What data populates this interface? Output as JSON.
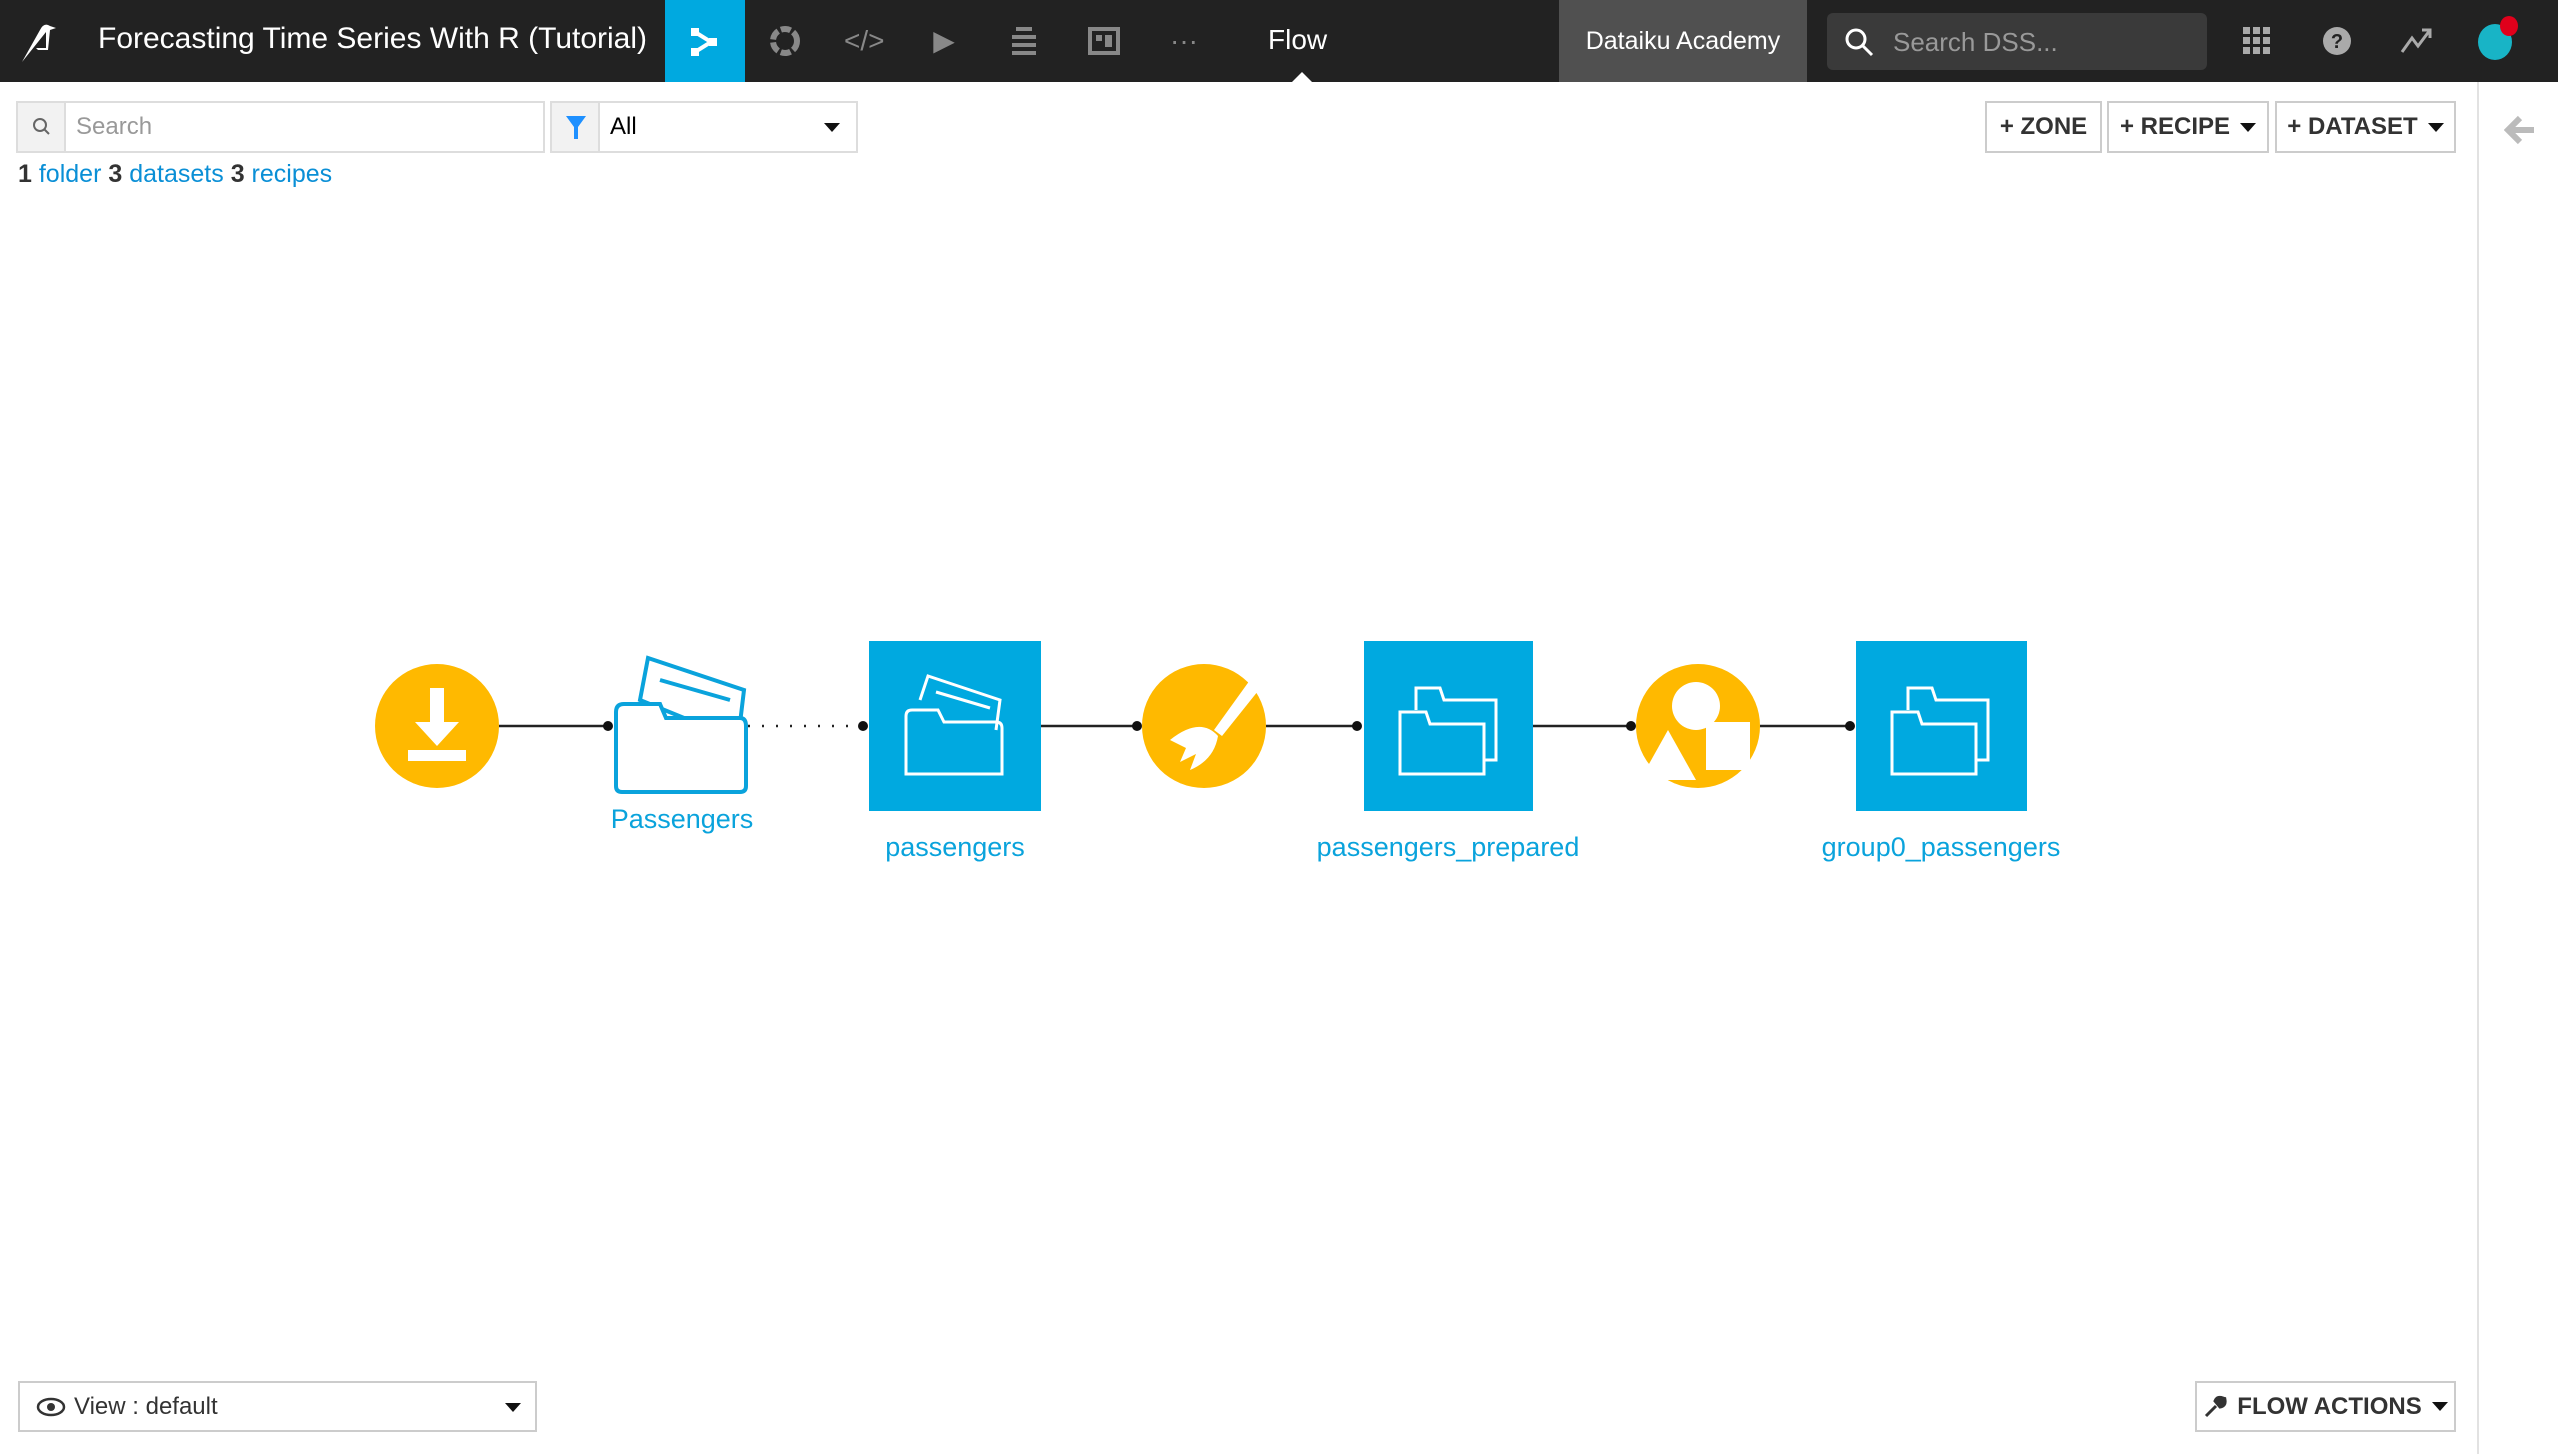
{
  "header": {
    "project_title": "Forecasting Time Series With R (Tutorial)",
    "nav_icons": [
      "flow-icon",
      "recipes-icon",
      "code-icon",
      "run-icon",
      "deploy-icon",
      "dashboard-icon",
      "more-icon"
    ],
    "current_section": "Flow",
    "instance_name": "Dataiku Academy",
    "search_placeholder": "Search DSS...",
    "right_icons": [
      "apps-grid-icon",
      "help-icon",
      "activity-icon",
      "avatar"
    ],
    "accent": "#00a9e0",
    "notification_color": "#e0001b"
  },
  "toolbar": {
    "search_placeholder": "Search",
    "filter_value": "All",
    "counts": [
      {
        "n": "1",
        "label": "folder"
      },
      {
        "n": "3",
        "label": "datasets"
      },
      {
        "n": "3",
        "label": "recipes"
      }
    ],
    "zone_label": "+ ZONE",
    "recipe_label": "+ RECIPE",
    "dataset_label": "+ DATASET"
  },
  "flow": {
    "nodes": [
      {
        "type": "download-recipe",
        "label": ""
      },
      {
        "type": "managed-folder",
        "label": "Passengers"
      },
      {
        "type": "dataset",
        "label": "passengers"
      },
      {
        "type": "prepare-recipe",
        "label": ""
      },
      {
        "type": "dataset",
        "label": "passengers_prepared"
      },
      {
        "type": "split-recipe",
        "label": ""
      },
      {
        "type": "dataset",
        "label": "group0_passengers"
      }
    ],
    "recipe_color": "#ffb900",
    "dataset_color": "#00a9e0"
  },
  "footer": {
    "view_label": "View : default",
    "flow_actions_label": "FLOW ACTIONS"
  }
}
